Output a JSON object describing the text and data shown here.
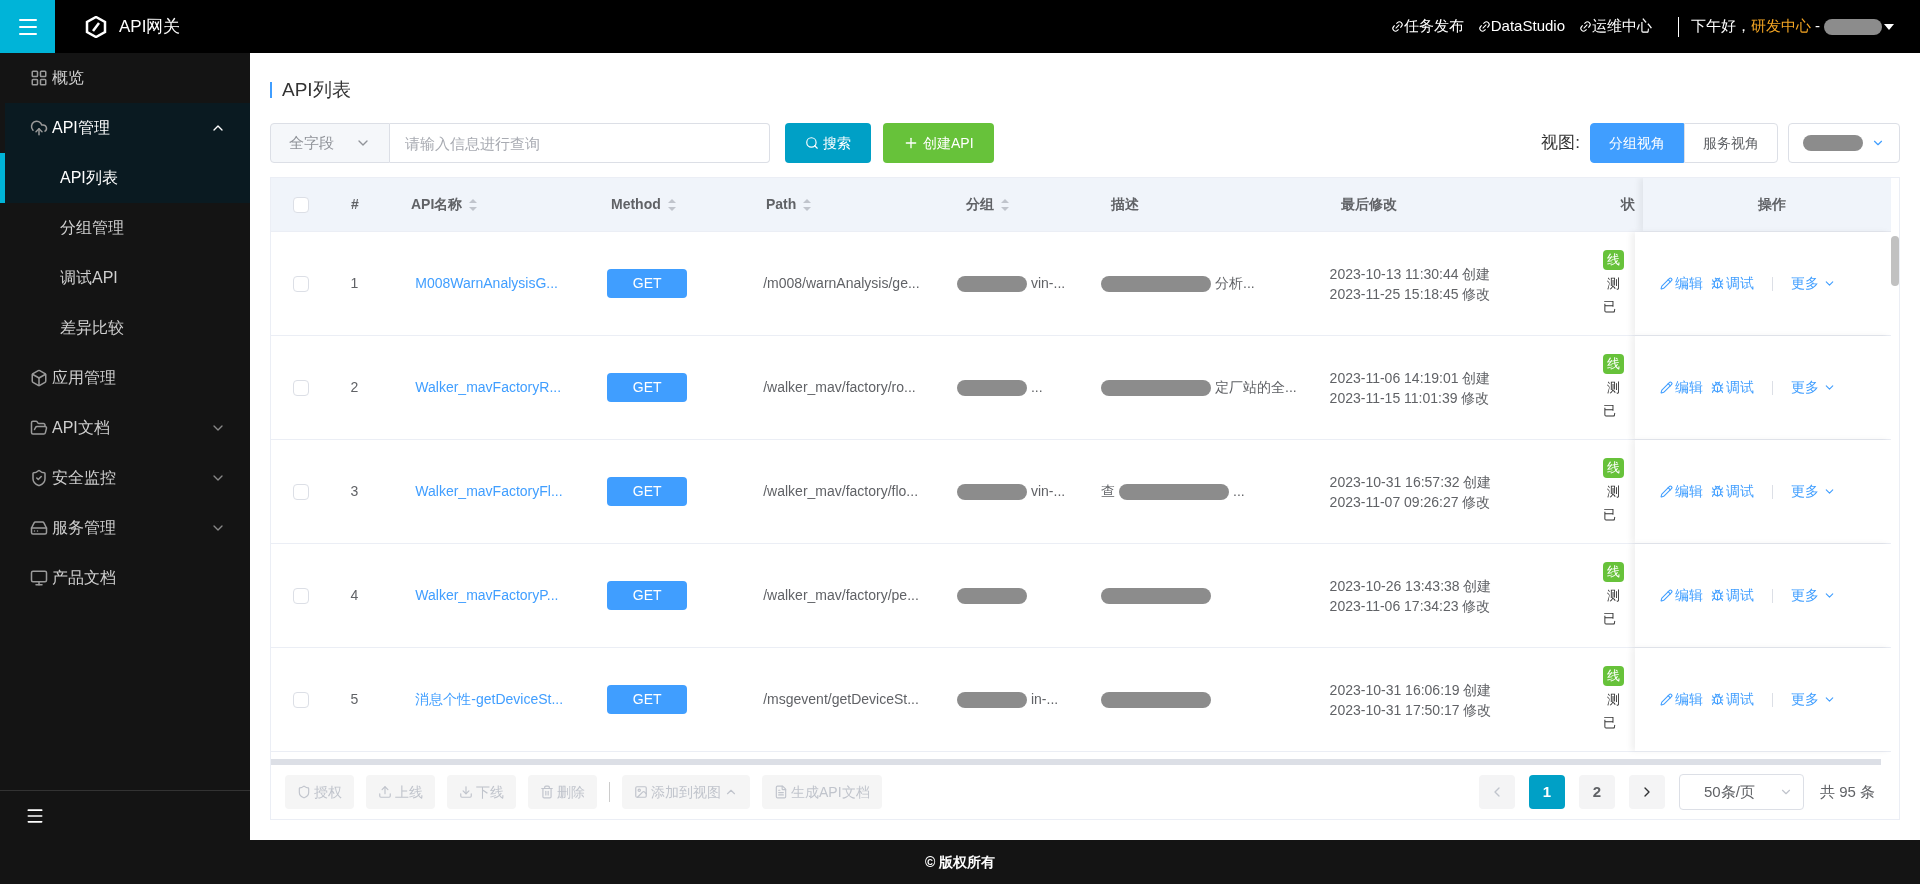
{
  "header": {
    "app_name": "API网关",
    "links": [
      "任务发布",
      "DataStudio",
      "运维中心"
    ],
    "greeting": "下午好，",
    "org": "研发中心",
    "separator": "-",
    "user_redacted": true
  },
  "sidebar": {
    "items": [
      {
        "kind": "overview",
        "label": "概览"
      },
      {
        "kind": "api",
        "label": "API管理",
        "expanded": true,
        "children": [
          {
            "label": "API列表",
            "selected": true
          },
          {
            "label": "分组管理",
            "selected": false
          },
          {
            "label": "调试API",
            "selected": false
          },
          {
            "label": "差异比较",
            "selected": false
          }
        ]
      },
      {
        "kind": "app",
        "label": "应用管理"
      },
      {
        "kind": "docs",
        "label": "API文档",
        "expanded": false
      },
      {
        "kind": "security",
        "label": "安全监控",
        "expanded": false
      },
      {
        "kind": "service",
        "label": "服务管理",
        "expanded": false
      },
      {
        "kind": "product",
        "label": "产品文档"
      }
    ]
  },
  "page_title": "API列表",
  "search": {
    "field": "全字段",
    "placeholder": "请输入信息进行查询",
    "search_button": "搜索",
    "create_button": "创建API"
  },
  "view": {
    "label": "视图:",
    "options": [
      {
        "label": "分组视角",
        "selected": true
      },
      {
        "label": "服务视角",
        "selected": false
      }
    ],
    "dropdown_redacted": true
  },
  "table": {
    "all_checked": false,
    "columns": [
      {
        "label": "#"
      },
      {
        "label": "API名称",
        "sortable": true
      },
      {
        "label": "Method",
        "sortable": true
      },
      {
        "label": "Path",
        "sortable": true
      },
      {
        "label": "分组",
        "sortable": true
      },
      {
        "label": "描述"
      },
      {
        "label": "最后修改"
      },
      {
        "label": "状"
      },
      {
        "label": "操作"
      }
    ],
    "rows": [
      {
        "checked": false,
        "index": "1",
        "name": "M008WarnAnalysisG...",
        "method": "GET",
        "path": "/m008/warnAnalysis/ge...",
        "group": {
          "redacted": true,
          "text": "vin-..."
        },
        "desc": {
          "redacted": true,
          "text": "分析..."
        },
        "created": "2023-10-13 11:30:44 创建",
        "modified": "2023-11-25 15:18:45 修改",
        "status": [
          "线",
          "测",
          "已"
        ],
        "actions": {
          "edit": "编辑",
          "debug": "调试",
          "more": "更多"
        }
      },
      {
        "checked": false,
        "index": "2",
        "name": "Walker_mavFactoryR...",
        "method": "GET",
        "path": "/walker_mav/factory/ro...",
        "group": {
          "redacted": true,
          "text": "..."
        },
        "desc": {
          "redacted": true,
          "text": "定厂站的全..."
        },
        "created": "2023-11-06 14:19:01 创建",
        "modified": "2023-11-15 11:01:39 修改",
        "status": [
          "线",
          "测",
          "已"
        ],
        "actions": {
          "edit": "编辑",
          "debug": "调试",
          "more": "更多"
        }
      },
      {
        "checked": false,
        "index": "3",
        "name": "Walker_mavFactoryFl...",
        "method": "GET",
        "path": "/walker_mav/factory/flo...",
        "group": {
          "redacted": true,
          "text": "vin-..."
        },
        "desc": {
          "redacted": true,
          "lead": "查",
          "text": "..."
        },
        "created": "2023-10-31 16:57:32 创建",
        "modified": "2023-11-07 09:26:27 修改",
        "status": [
          "线",
          "测",
          "已"
        ],
        "actions": {
          "edit": "编辑",
          "debug": "调试",
          "more": "更多"
        }
      },
      {
        "checked": false,
        "index": "4",
        "name": "Walker_mavFactoryP...",
        "method": "GET",
        "path": "/walker_mav/factory/pe...",
        "group": {
          "redacted": true
        },
        "desc": {
          "redacted": true
        },
        "created": "2023-10-26 13:43:38 创建",
        "modified": "2023-11-06 17:34:23 修改",
        "status": [
          "线",
          "测",
          "已"
        ],
        "actions": {
          "edit": "编辑",
          "debug": "调试",
          "more": "更多"
        }
      },
      {
        "checked": false,
        "index": "5",
        "name": "消息个性-getDeviceSt...",
        "method": "GET",
        "path": "/msgevent/getDeviceSt...",
        "group": {
          "redacted": true,
          "text": "in-..."
        },
        "desc": {
          "redacted": true
        },
        "created": "2023-10-31 16:06:19 创建",
        "modified": "2023-10-31 17:50:17 修改",
        "status": [
          "线",
          "测",
          "已"
        ],
        "actions": {
          "edit": "编辑",
          "debug": "调试",
          "more": "更多"
        }
      }
    ]
  },
  "bulk_actions": [
    {
      "kind": "authorize",
      "label": "授权",
      "disabled": true
    },
    {
      "kind": "online",
      "label": "上线",
      "disabled": true
    },
    {
      "kind": "offline",
      "label": "下线",
      "disabled": true
    },
    {
      "kind": "delete",
      "label": "删除",
      "disabled": true
    },
    {
      "kind": "add_view",
      "label": "添加到视图",
      "disabled": true
    },
    {
      "kind": "gen_doc",
      "label": "生成API文档",
      "disabled": true
    }
  ],
  "pagination": {
    "prev_disabled": true,
    "pages": [
      {
        "label": "1",
        "selected": true
      },
      {
        "label": "2",
        "selected": false
      }
    ],
    "page_size": "50条/页",
    "total": "共 95 条"
  },
  "footer": "© 版权所有"
}
